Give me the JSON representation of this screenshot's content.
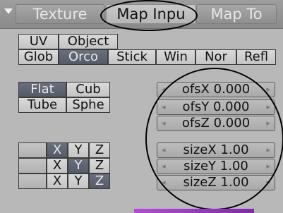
{
  "tabs": [
    {
      "label": "Texture",
      "active": false
    },
    {
      "label": "Map Inpu",
      "active": true
    },
    {
      "label": "Map To",
      "active": false
    }
  ],
  "coords": {
    "row1": [
      {
        "label": "UV",
        "selected": false
      },
      {
        "label": "Object",
        "selected": false
      }
    ],
    "row2": [
      {
        "label": "Glob",
        "selected": false
      },
      {
        "label": "Orco",
        "selected": true
      },
      {
        "label": "Stick",
        "selected": false
      },
      {
        "label": "Win",
        "selected": false
      },
      {
        "label": "Nor",
        "selected": false
      },
      {
        "label": "Refl",
        "selected": false
      }
    ]
  },
  "mapping": {
    "row1": [
      {
        "label": "Flat",
        "selected": true
      },
      {
        "label": "Cub",
        "selected": false
      }
    ],
    "row2": [
      {
        "label": "Tube",
        "selected": false
      },
      {
        "label": "Sphe",
        "selected": false
      }
    ]
  },
  "projection": {
    "rows": [
      [
        "X",
        "Y",
        "Z"
      ],
      [
        "X",
        "Y",
        "Z"
      ],
      [
        "X",
        "Y",
        "Z"
      ]
    ],
    "selected": [
      [
        0,
        0
      ],
      [
        1,
        1
      ],
      [
        2,
        2
      ]
    ]
  },
  "offset": [
    {
      "label": "ofsX",
      "value": "0.000"
    },
    {
      "label": "ofsY",
      "value": "0.000"
    },
    {
      "label": "ofsZ",
      "value": "0.000"
    }
  ],
  "size": [
    {
      "label": "sizeX",
      "value": "1.00"
    },
    {
      "label": "sizeY",
      "value": "1.00"
    },
    {
      "label": "sizeZ",
      "value": "1.00"
    }
  ],
  "colors": {
    "panel_bg": "#b8b8b8",
    "selected_button": "#5f6472",
    "accent_bar": "#b44bd4"
  }
}
